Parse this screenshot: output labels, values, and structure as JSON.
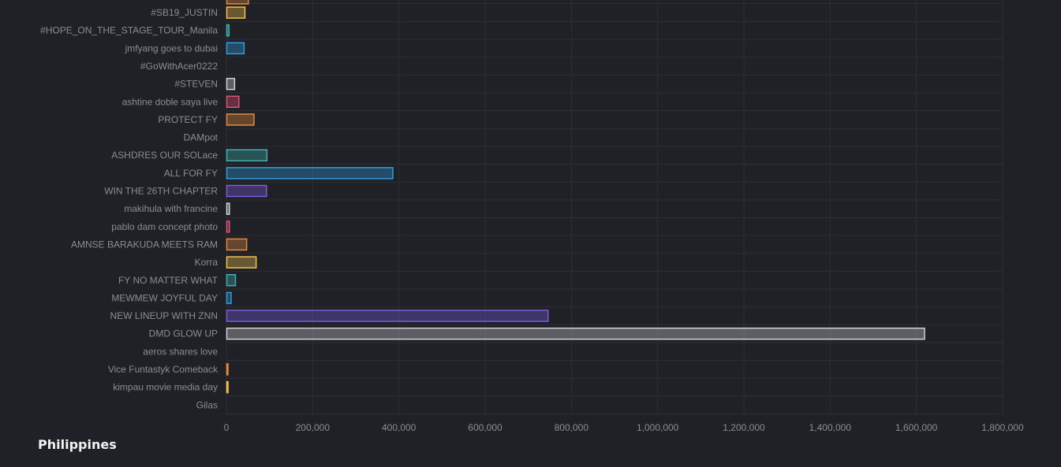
{
  "footer": {
    "region": "Philippines"
  },
  "colors": {
    "background": "#1f2126",
    "grid": "#2c2f35",
    "text": "#8a8d93",
    "palette": [
      "#e58a3c",
      "#f2c14e",
      "#3fb1b1",
      "#2d9de0",
      "#7b5ce0",
      "#cfd2d6",
      "#e0517a"
    ]
  },
  "chart_data": {
    "type": "bar",
    "orientation": "horizontal",
    "categories": [
      "#SB19_JUSTIN",
      "#HOPE_ON_THE_STAGE_TOUR_Manila",
      "jmfyang goes to dubai",
      "#GoWithAcer0222",
      "#STEVEN",
      "ashtine doble saya live",
      "PROTECT FY",
      "DAMpot",
      "ASHDRES OUR SOLace",
      "ALL FOR FY",
      "WIN THE 26TH CHAPTER",
      "makihula with francine",
      "pablo dam concept photo",
      "AMNSE BARAKUDA MEETS RAM",
      "Korra",
      "FY NO MATTER WHAT",
      "MEWMEW JOYFUL DAY",
      "NEW LINEUP WITH ZNN",
      "DMD GLOW UP",
      "aeros shares love",
      "Vice Funtastyk Comeback",
      "kimpau movie media day",
      "Gilas"
    ],
    "values": [
      42000,
      5000,
      40000,
      0,
      18000,
      28000,
      63000,
      0,
      93000,
      385000,
      92000,
      6000,
      6000,
      46000,
      68000,
      20000,
      10000,
      745000,
      1618000,
      0,
      2000,
      2000,
      0
    ],
    "bar_colors": [
      "#f2c14e",
      "#3fb1b1",
      "#2d9de0",
      "#7b5ce0",
      "#cfd2d6",
      "#e0517a",
      "#e58a3c",
      "#f2c14e",
      "#3fb1b1",
      "#2d9de0",
      "#7b5ce0",
      "#cfd2d6",
      "#e0517a",
      "#e58a3c",
      "#f2c14e",
      "#3fb1b1",
      "#2d9de0",
      "#7b5ce0",
      "#cfd2d6",
      "#e0517a",
      "#e58a3c",
      "#f2c14e",
      "#3fb1b1"
    ],
    "partial_top_bar": {
      "value": 50000,
      "color": "#e58a3c"
    },
    "xlim": [
      0,
      1800000
    ],
    "xticks": [
      0,
      200000,
      400000,
      600000,
      800000,
      1000000,
      1200000,
      1400000,
      1600000,
      1800000
    ],
    "xtick_labels": [
      "0",
      "200,000",
      "400,000",
      "600,000",
      "800,000",
      "1,000,000",
      "1,200,000",
      "1,400,000",
      "1,600,000",
      "1,800,000"
    ],
    "grid": true,
    "legend": "none"
  }
}
